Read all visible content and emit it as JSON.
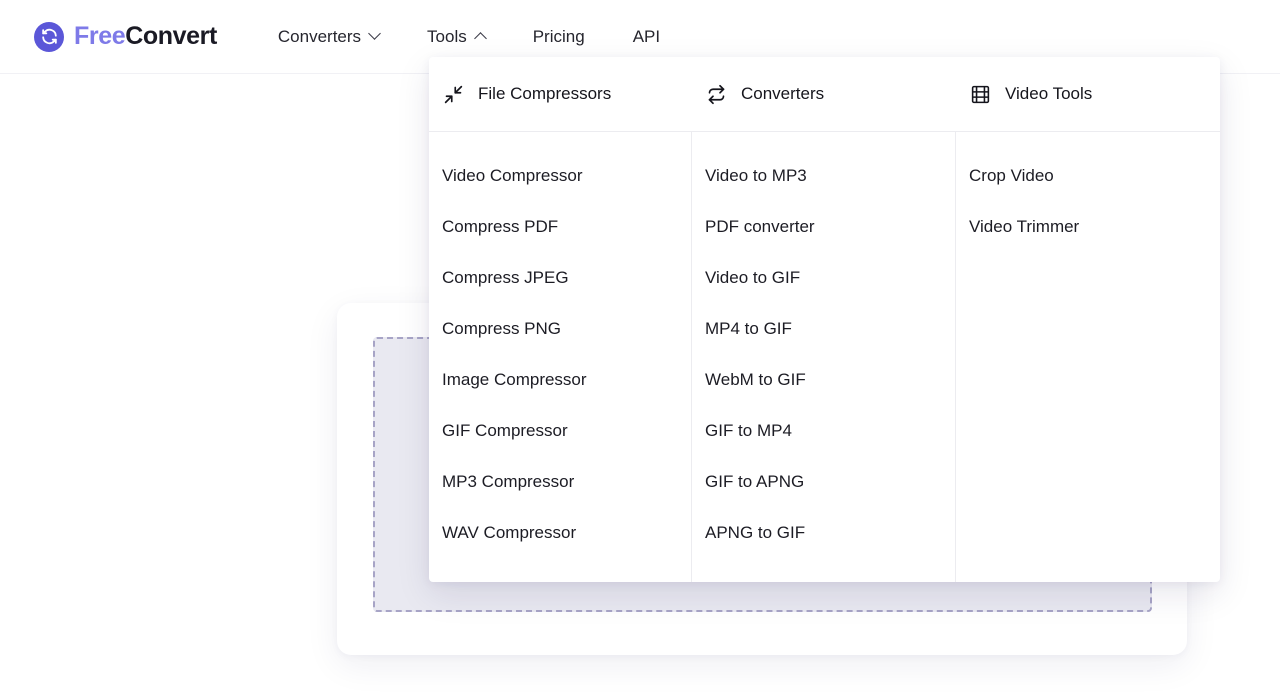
{
  "brand": {
    "name_part1": "Free",
    "name_part2": "Convert",
    "logo_icon": "refresh-circle-icon",
    "accent_color": "#5b57d8",
    "wordmark_light_color": "#7e7ae8",
    "wordmark_dark_color": "#1a1a24"
  },
  "header": {
    "nav": [
      {
        "label": "Converters",
        "icon": "chevron-down-icon",
        "expanded": false
      },
      {
        "label": "Tools",
        "icon": "chevron-up-icon",
        "expanded": true
      },
      {
        "label": "Pricing",
        "icon": "",
        "expanded": false
      },
      {
        "label": "API",
        "icon": "",
        "expanded": false
      }
    ]
  },
  "dropdown": {
    "open_for": "Tools",
    "columns": [
      {
        "heading": "File Compressors",
        "heading_icon": "compress-arrows-icon",
        "items": [
          "Video Compressor",
          "Compress PDF",
          "Compress JPEG",
          "Compress PNG",
          "Image Compressor",
          "GIF Compressor",
          "MP3 Compressor",
          "WAV Compressor"
        ]
      },
      {
        "heading": "Converters",
        "heading_icon": "convert-repeat-icon",
        "items": [
          "Video to MP3",
          "PDF converter",
          "Video to GIF",
          "MP4 to GIF",
          "WebM to GIF",
          "GIF to MP4",
          "GIF to APNG",
          "APNG to GIF"
        ]
      },
      {
        "heading": "Video Tools",
        "heading_icon": "film-strip-icon",
        "items": [
          "Crop Video",
          "Video Trimmer"
        ]
      }
    ]
  },
  "hero": {
    "card_background": "#ffffff",
    "dropzone": {
      "name": "file-dropzone",
      "fill_color": "#e9e9f1",
      "border_color": "#a7a4c6",
      "border_style": "dashed"
    }
  }
}
